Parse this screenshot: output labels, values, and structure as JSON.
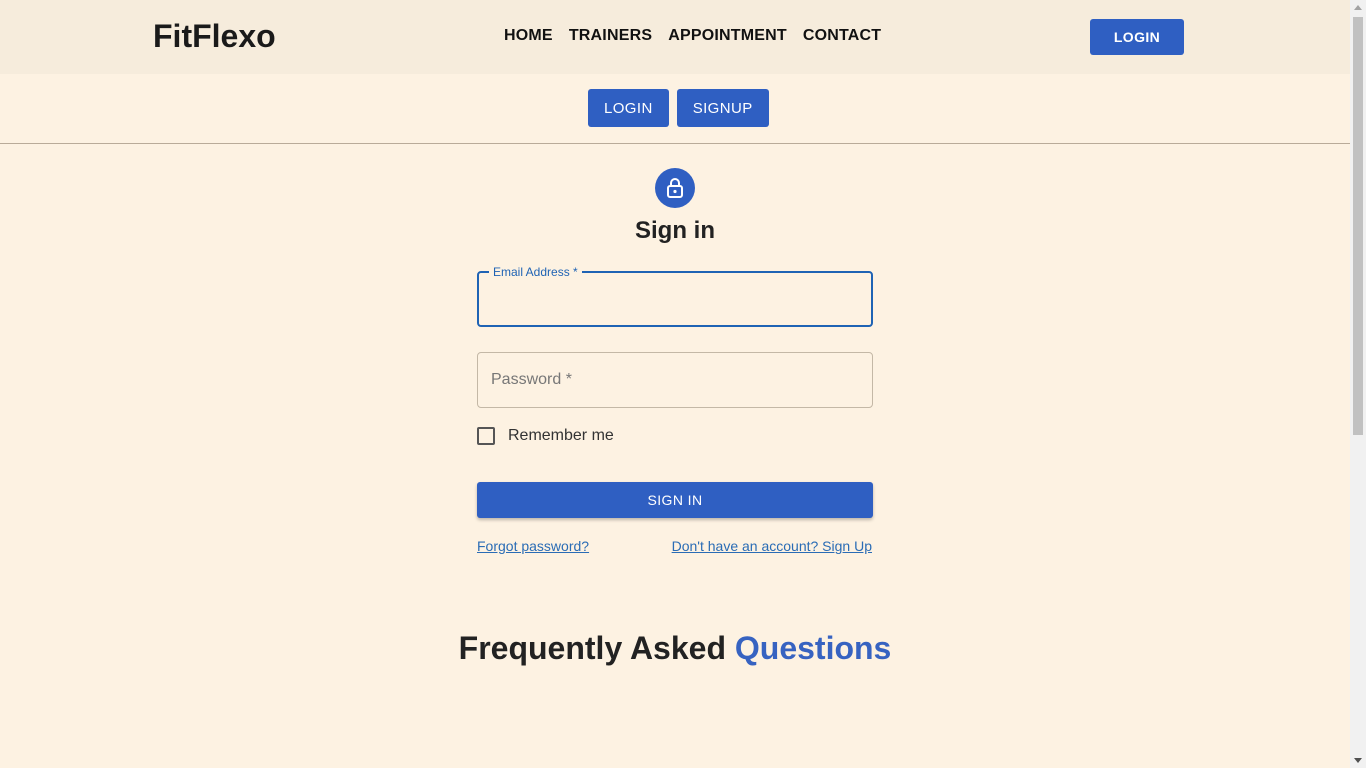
{
  "navbar": {
    "brand": "FitFlexo",
    "links": [
      "HOME",
      "TRAINERS",
      "APPOINTMENT",
      "CONTACT"
    ],
    "login_label": "LOGIN"
  },
  "auth_switch": {
    "login_label": "LOGIN",
    "signup_label": "SIGNUP"
  },
  "signin": {
    "icon": "lock-icon",
    "title": "Sign in",
    "email_label": "Email Address *",
    "email_value": "",
    "password_label": "Password *",
    "password_value": "",
    "remember_label": "Remember me",
    "remember_checked": false,
    "submit_label": "SIGN IN",
    "forgot_link": "Forgot password?",
    "signup_link": "Don't have an account? Sign Up"
  },
  "faq": {
    "title_main": "Frequently Asked",
    "title_accent": "Questions"
  },
  "colors": {
    "primary": "#2f5fc2",
    "background": "#fdf2e2",
    "navbar": "#f6ecdc",
    "focus": "#1f63b4"
  }
}
